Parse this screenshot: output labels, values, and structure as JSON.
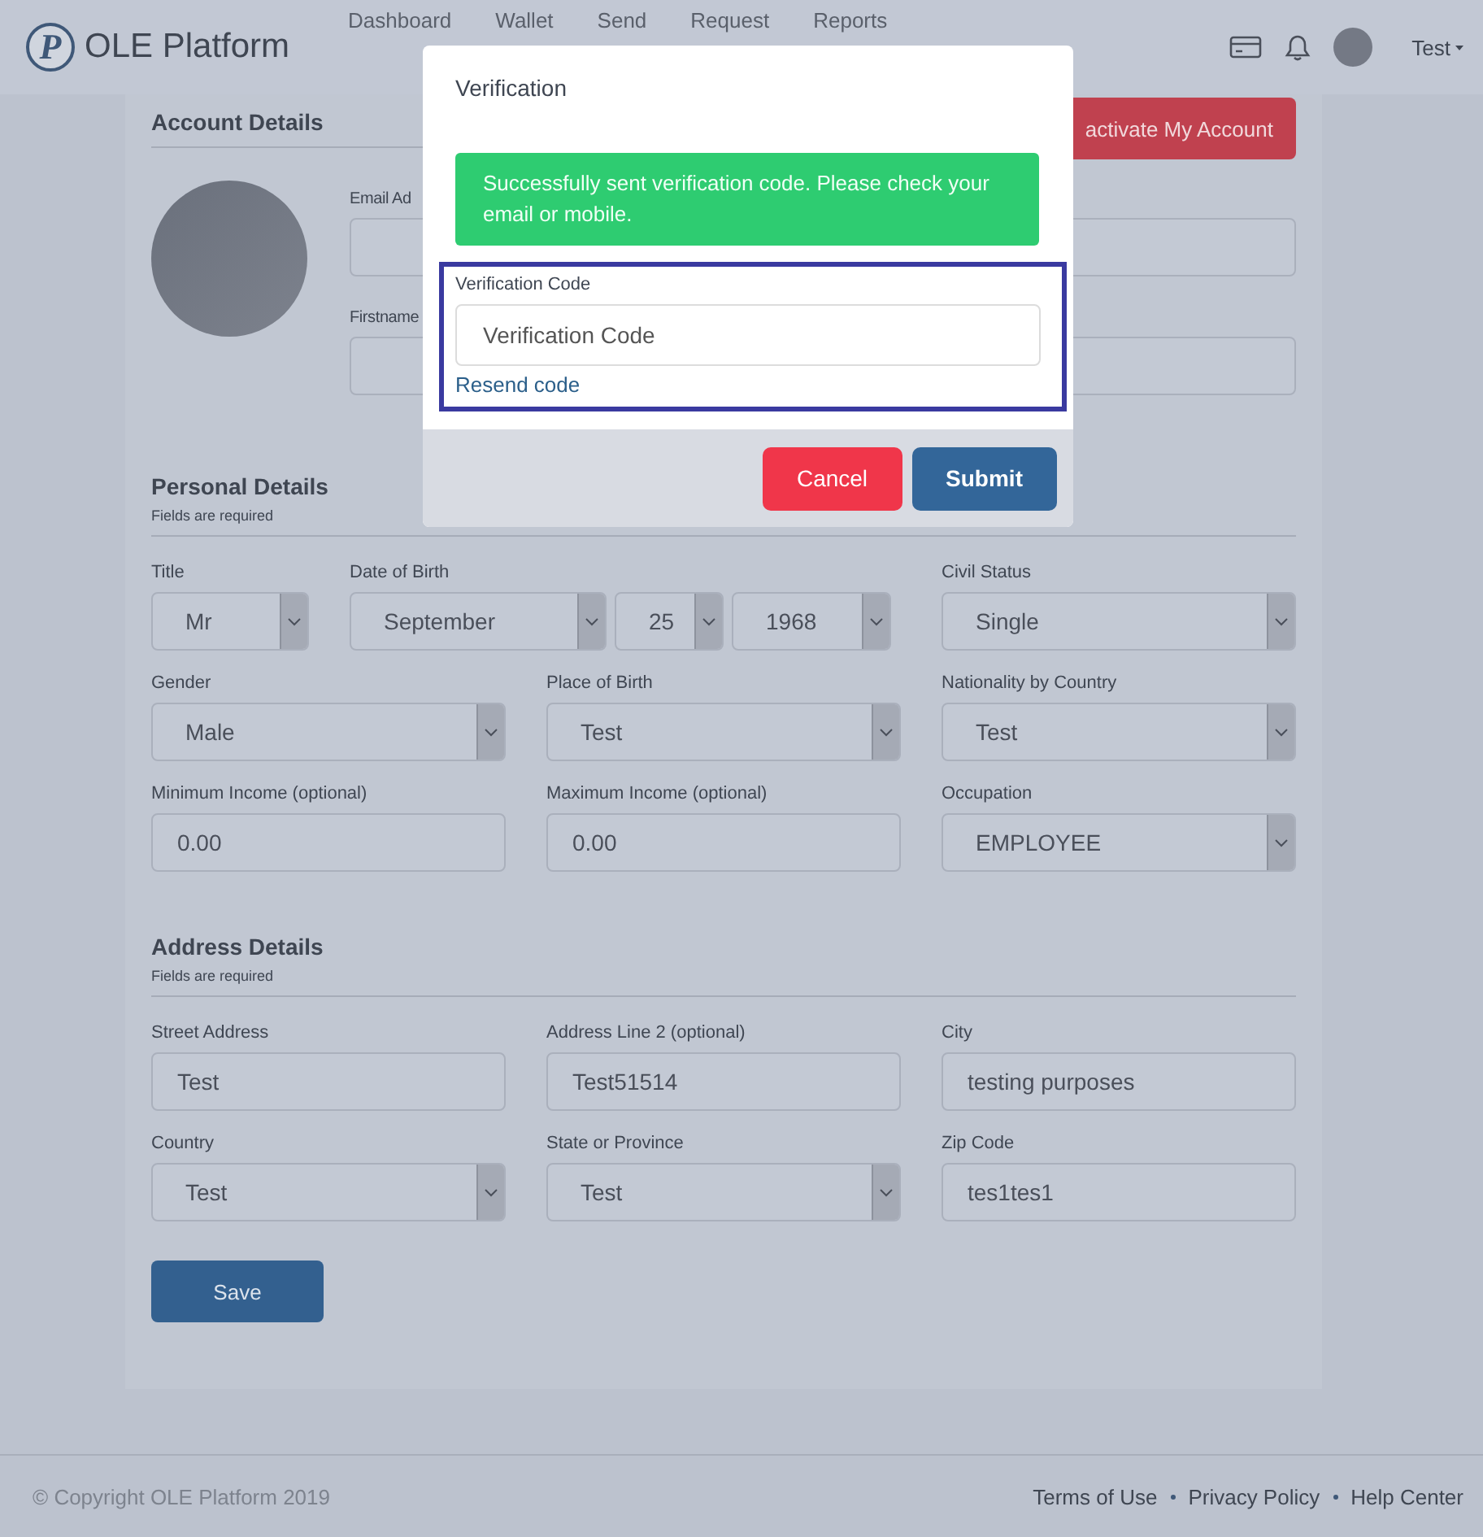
{
  "header": {
    "logo_letter": "P",
    "brand": "OLE Platform",
    "nav": [
      {
        "label": "Dashboard"
      },
      {
        "label": "Wallet"
      },
      {
        "label": "Send"
      },
      {
        "label": "Request"
      },
      {
        "label": "Reports"
      }
    ],
    "user": "Test"
  },
  "account": {
    "title": "Account Details",
    "action": "activate My Account",
    "fields": [
      {
        "label": "Email Ad"
      },
      {
        "label": "Firstname"
      }
    ]
  },
  "sections": [
    {
      "title": "Personal Details",
      "note": "Fields are required",
      "rows": [
        {
          "fields": [
            {
              "label": "Title",
              "kind": "select",
              "value": "Mr"
            },
            {
              "label": "Date of Birth",
              "kind": "date",
              "parts": [
                "September",
                "25",
                "1968"
              ]
            },
            {
              "label": "Civil Status",
              "kind": "select",
              "value": "Single"
            }
          ]
        },
        {
          "fields": [
            {
              "label": "Gender",
              "kind": "select",
              "value": "Male"
            },
            {
              "label": "Place of Birth",
              "kind": "select",
              "value": "Test"
            },
            {
              "label": "Nationality by Country",
              "kind": "select",
              "value": "Test"
            }
          ]
        },
        {
          "fields": [
            {
              "label": "Minimum Income (optional)",
              "kind": "input",
              "value": "0.00"
            },
            {
              "label": "Maximum Income (optional)",
              "kind": "input",
              "value": "0.00"
            },
            {
              "label": "Occupation",
              "kind": "select",
              "value": "EMPLOYEE"
            }
          ]
        }
      ]
    },
    {
      "title": "Address Details",
      "note": "Fields are required",
      "rows": [
        {
          "fields": [
            {
              "label": "Street Address",
              "kind": "input",
              "value": "Test"
            },
            {
              "label": "Address Line 2 (optional)",
              "kind": "input",
              "value": "Test51514"
            },
            {
              "label": "City",
              "kind": "input",
              "value": "testing purposes"
            }
          ]
        },
        {
          "fields": [
            {
              "label": "Country",
              "kind": "select",
              "value": "Test"
            },
            {
              "label": "State or Province",
              "kind": "select",
              "value": "Test"
            },
            {
              "label": "Zip Code",
              "kind": "input",
              "value": "tes1tes1"
            }
          ]
        }
      ]
    }
  ],
  "save": "Save",
  "modal": {
    "title": "Verification",
    "alert": "Successfully sent verification code. Please check your email or mobile.",
    "code_field": {
      "label": "Verification Code",
      "placeholder": "Verification Code"
    },
    "resend": "Resend code",
    "buttons": [
      {
        "label": "Cancel",
        "kind": "danger"
      },
      {
        "label": "Submit",
        "kind": "primary"
      }
    ]
  },
  "footer": {
    "copyright": "© Copyright OLE Platform 2019",
    "links": [
      "Terms of Use",
      "Privacy Policy",
      "Help Center"
    ]
  }
}
